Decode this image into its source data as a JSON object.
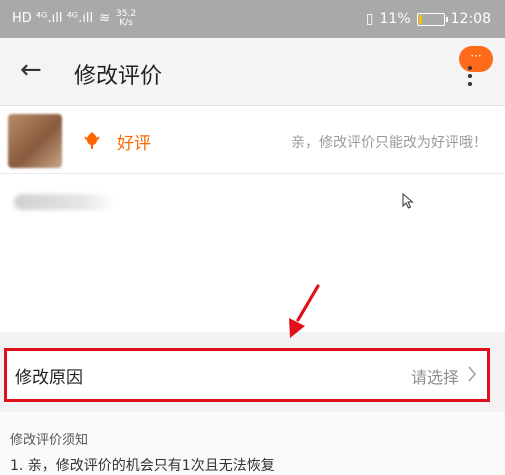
{
  "status_bar": {
    "left_indicators": "HD ⁴ᴳ.ıll ⁴ᴳ.ıll",
    "speed_value": "35.2",
    "speed_unit": "K/s",
    "battery_percent": "11%",
    "battery_level": 0.11,
    "time": "12:08"
  },
  "header": {
    "title": "修改评价",
    "badge_text": "···"
  },
  "review": {
    "rating_label": "好评",
    "rating_hint": "亲，修改评价只能改为好评哦！"
  },
  "reason": {
    "label": "修改原因",
    "value": "请选择",
    "highlight_color": "#e0101a"
  },
  "notice": {
    "title": "修改评价须知",
    "lines": [
      "1. 亲，修改评价的机会只有1次且无法恢复"
    ]
  },
  "colors": {
    "accent": "#ff6600",
    "annotation": "#e0101a"
  }
}
